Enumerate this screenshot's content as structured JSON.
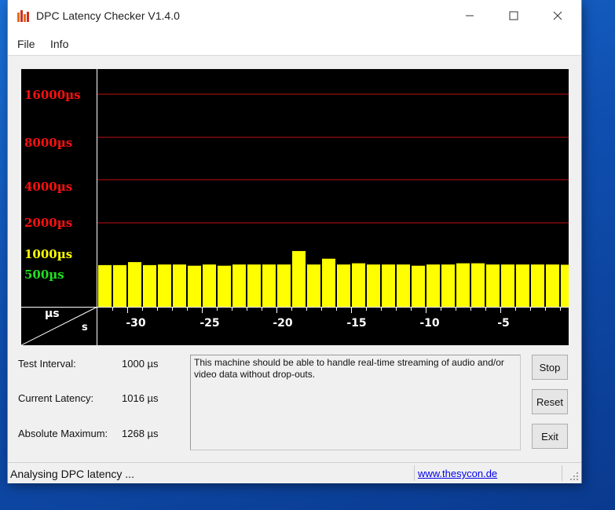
{
  "window": {
    "title": "DPC Latency Checker V1.4.0"
  },
  "menu": {
    "file": "File",
    "info": "Info"
  },
  "graph": {
    "y_labels": [
      {
        "text": "16000µs",
        "color": "#ff1010"
      },
      {
        "text": "8000µs",
        "color": "#ff1010"
      },
      {
        "text": "4000µs",
        "color": "#ff1010"
      },
      {
        "text": "2000µs",
        "color": "#ff1010"
      },
      {
        "text": "1000µs",
        "color": "#ffff00"
      },
      {
        "text": "500µs",
        "color": "#20e020"
      }
    ],
    "corner_unit_y": "µs",
    "corner_unit_x": "s",
    "x_ticks": [
      "-30",
      "-25",
      "-20",
      "-15",
      "-10",
      "-5"
    ]
  },
  "chart_data": {
    "type": "bar",
    "xlabel": "s",
    "ylabel": "µs",
    "y_scale": "log2",
    "ylim": [
      250,
      32000
    ],
    "xlim": [
      -32,
      0
    ],
    "bar_color": "#ffff00",
    "gridlines": [
      16000,
      8000,
      4000,
      2000
    ],
    "x": [
      -32,
      -31,
      -30,
      -29,
      -28,
      -27,
      -26,
      -25,
      -24,
      -23,
      -22,
      -21,
      -20,
      -19,
      -18,
      -17,
      -16,
      -15,
      -14,
      -13,
      -12,
      -11,
      -10,
      -9,
      -8,
      -7,
      -6,
      -5,
      -4,
      -3,
      -2,
      -1
    ],
    "values": [
      1010,
      1010,
      1060,
      1010,
      1020,
      1020,
      1000,
      1020,
      1000,
      1020,
      1020,
      1020,
      1020,
      1268,
      1020,
      1120,
      1020,
      1040,
      1020,
      1020,
      1020,
      1000,
      1020,
      1020,
      1040,
      1040,
      1020,
      1020,
      1020,
      1020,
      1020,
      1016
    ]
  },
  "info": {
    "test_interval_label": "Test Interval:",
    "test_interval_value": "1000 µs",
    "current_latency_label": "Current Latency:",
    "current_latency_value": "1016 µs",
    "absolute_max_label": "Absolute Maximum:",
    "absolute_max_value": "1268 µs"
  },
  "message": "This machine should be able to handle real-time streaming of audio and/or video data without drop-outs.",
  "buttons": {
    "stop": "Stop",
    "reset": "Reset",
    "exit": "Exit"
  },
  "status": {
    "text": "Analysing DPC latency ...",
    "link": "www.thesycon.de"
  }
}
